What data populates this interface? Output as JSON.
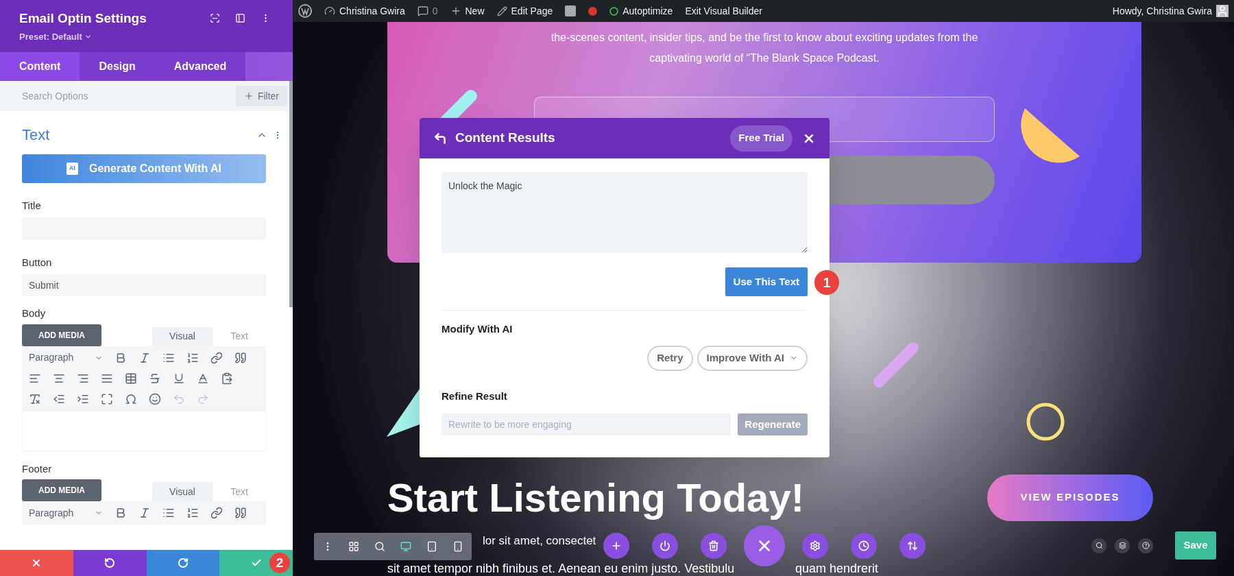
{
  "settings_panel": {
    "title": "Email Optin Settings",
    "preset": "Preset: Default",
    "tabs": [
      {
        "label": "Content",
        "selected": true
      },
      {
        "label": "Design",
        "selected": false
      },
      {
        "label": "Advanced",
        "selected": false
      }
    ],
    "search": {
      "placeholder": "Search Options"
    },
    "filter_button": "Filter",
    "section": {
      "title": "Text",
      "expanded": true
    },
    "ai_badge": "AI",
    "ai_button": "Generate Content With AI",
    "fields": [
      {
        "label": "Title"
      },
      {
        "label": "Button",
        "value": "Submit"
      }
    ],
    "editors": [
      {
        "label": "Body",
        "add_media": "ADD MEDIA",
        "format": "Paragraph",
        "tabs": [
          {
            "label": "Visual",
            "selected": true
          },
          {
            "label": "Text",
            "selected": false
          }
        ]
      },
      {
        "label": "Footer",
        "add_media": "ADD MEDIA",
        "format": "Paragraph",
        "tabs": [
          {
            "label": "Visual",
            "selected": true
          },
          {
            "label": "Text",
            "selected": false
          }
        ]
      }
    ]
  },
  "action_bar": [
    {
      "kind": "discard"
    },
    {
      "kind": "undo"
    },
    {
      "kind": "redo"
    },
    {
      "kind": "save",
      "badge": "2"
    }
  ],
  "admin_bar": {
    "items": [
      {
        "kind": "wp"
      },
      {
        "kind": "site",
        "label": "Christina Gwira"
      },
      {
        "kind": "comments",
        "label": "0"
      },
      {
        "kind": "new",
        "label": "New"
      },
      {
        "kind": "edit",
        "label": "Edit Page"
      },
      {
        "kind": "yoast"
      },
      {
        "kind": "status"
      },
      {
        "kind": "autoptimize",
        "label": "Autoptimize"
      },
      {
        "kind": "exit",
        "label": "Exit Visual Builder"
      }
    ],
    "greeting": "Howdy, Christina Gwira"
  },
  "page": {
    "intro": [
      "the-scenes content, insider tips, and be the first to know about exciting updates from the",
      "captivating world of “The Blank Space Podcast."
    ],
    "heading": "Start Listening Today!",
    "cta": "VIEW EPISODES",
    "body_lines": [
      "lor sit amet, consectet",
      "sit amet tempor nibh finibus et. Aenean eu enim justo. Vestibulu",
      "quam hendrerit"
    ]
  },
  "modal": {
    "title": "Content Results",
    "trial_button": "Free Trial",
    "result": "Unlock the Magic",
    "use_button": "Use This Text",
    "use_badge": "1",
    "modify_label": "Modify With AI",
    "retry": "Retry",
    "improve": "Improve With AI",
    "refine_label": "Refine Result",
    "refine_placeholder": "Rewrite to be more engaging",
    "regenerate": "Regenerate"
  },
  "builder_toolbar": {
    "views": [
      {
        "kind": "desktop",
        "selected": true
      },
      {
        "kind": "tablet",
        "selected": false
      },
      {
        "kind": "phone",
        "selected": false
      }
    ],
    "actions": [
      {
        "kind": "add"
      },
      {
        "kind": "power"
      },
      {
        "kind": "trash"
      },
      {
        "kind": "close"
      },
      {
        "kind": "settings"
      },
      {
        "kind": "history"
      },
      {
        "kind": "sort"
      }
    ],
    "save": "Save"
  }
}
